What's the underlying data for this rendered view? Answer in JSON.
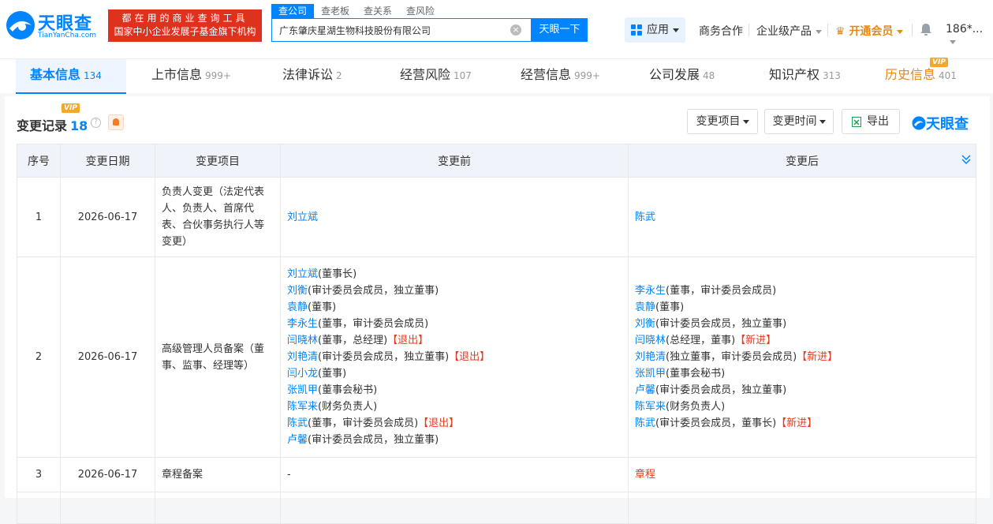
{
  "header": {
    "logo_name": "天眼查",
    "logo_domain": "TianYanCha.com",
    "banner_line1": "都在用的商业查询工具",
    "banner_line2": "国家中小企业发展子基金旗下机构",
    "search_tabs": [
      "查公司",
      "查老板",
      "查关系",
      "查风险"
    ],
    "search_value": "广东肇庆星湖生物科技股份有限公司",
    "search_button": "天眼一下",
    "apps_label": "应用",
    "nav_business": "商务合作",
    "nav_enterprise": "企业级产品",
    "nav_vip": "开通会员",
    "user_label": "186*..."
  },
  "tabs": [
    {
      "label": "基本信息",
      "count": "134"
    },
    {
      "label": "上市信息",
      "count": "999+"
    },
    {
      "label": "法律诉讼",
      "count": "2"
    },
    {
      "label": "经营风险",
      "count": "107"
    },
    {
      "label": "经营信息",
      "count": "999+"
    },
    {
      "label": "公司发展",
      "count": "48"
    },
    {
      "label": "知识产权",
      "count": "313"
    },
    {
      "label": "历史信息",
      "count": "401"
    }
  ],
  "vip_text": "VIP",
  "section": {
    "title": "变更记录",
    "count": "18",
    "filter_item": "变更项目",
    "filter_time": "变更时间",
    "export": "导出",
    "brand": "天眼查"
  },
  "table": {
    "headers": [
      "序号",
      "变更日期",
      "变更项目",
      "变更前",
      "变更后"
    ],
    "rows": [
      {
        "no": "1",
        "date": "2026-06-17",
        "item": "负责人变更（法定代表人、负责人、首席代表、合伙事务执行人等变更）",
        "before": [
          {
            "name": "刘立斌",
            "role": "",
            "tag": ""
          }
        ],
        "after": [
          {
            "name": "陈武",
            "role": "",
            "tag": ""
          }
        ]
      },
      {
        "no": "2",
        "date": "2026-06-17",
        "item": "高级管理人员备案（董事、监事、经理等）",
        "before": [
          {
            "name": "刘立斌",
            "role": "(董事长)",
            "tag": ""
          },
          {
            "name": "刘衡",
            "role": "(审计委员会成员，独立董事)",
            "tag": ""
          },
          {
            "name": "袁静",
            "role": "(董事)",
            "tag": ""
          },
          {
            "name": "李永生",
            "role": "(董事，审计委员会成员)",
            "tag": ""
          },
          {
            "name": "闫晓林",
            "role": "(董事，总经理)",
            "tag": "【退出】"
          },
          {
            "name": "刘艳清",
            "role": "(审计委员会成员，独立董事)",
            "tag": "【退出】"
          },
          {
            "name": "闫小龙",
            "role": "(董事)",
            "tag": ""
          },
          {
            "name": "张凯甲",
            "role": "(董事会秘书)",
            "tag": ""
          },
          {
            "name": "陈军来",
            "role": "(财务负责人)",
            "tag": ""
          },
          {
            "name": "陈武",
            "role": "(董事，审计委员会成员)",
            "tag": "【退出】"
          },
          {
            "name": "卢馨",
            "role": "(审计委员会成员，独立董事)",
            "tag": ""
          }
        ],
        "after": [
          {
            "name": "李永生",
            "role": "(董事，审计委员会成员)",
            "tag": ""
          },
          {
            "name": "袁静",
            "role": "(董事)",
            "tag": ""
          },
          {
            "name": "刘衡",
            "role": "(审计委员会成员，独立董事)",
            "tag": ""
          },
          {
            "name": "闫晓林",
            "role": "(总经理，董事)",
            "tag": "【新进】"
          },
          {
            "name": "刘艳清",
            "role": "(独立董事，审计委员会成员)",
            "tag": "【新进】"
          },
          {
            "name": "张凯甲",
            "role": "(董事会秘书)",
            "tag": ""
          },
          {
            "name": "卢馨",
            "role": "(审计委员会成员，独立董事)",
            "tag": ""
          },
          {
            "name": "陈军来",
            "role": "(财务负责人)",
            "tag": ""
          },
          {
            "name": "陈武",
            "role": "(审计委员会成员，董事长)",
            "tag": "【新进】"
          }
        ]
      },
      {
        "no": "3",
        "date": "2026-06-17",
        "item": "章程备案",
        "before_text": "-",
        "after_text": "章程"
      }
    ]
  }
}
